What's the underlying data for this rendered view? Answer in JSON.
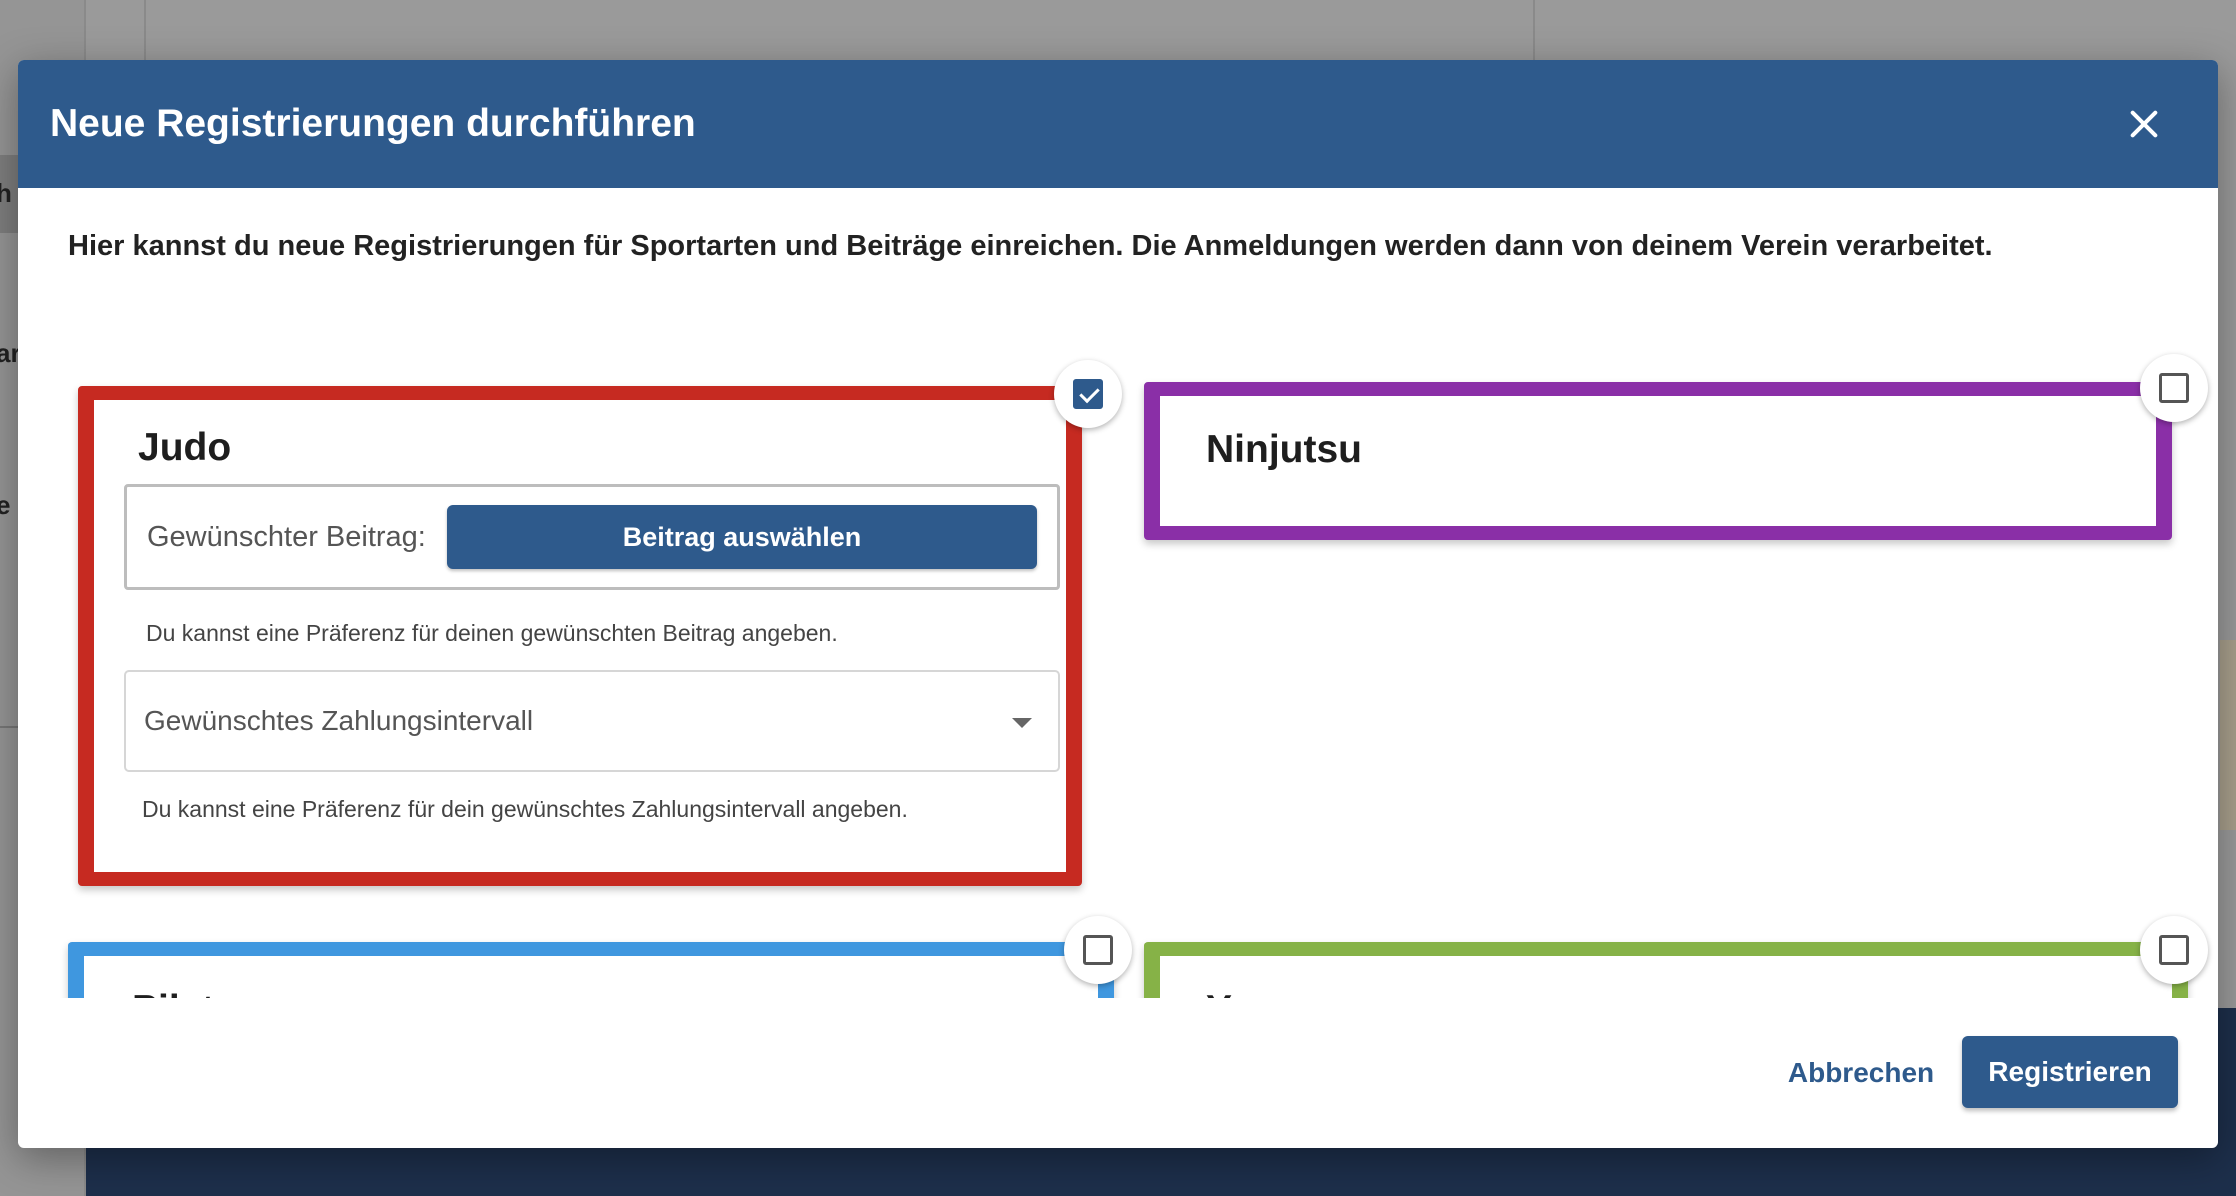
{
  "background": {
    "fragments": [
      "h",
      "ar",
      "e"
    ]
  },
  "dialog": {
    "title": "Neue Registrierungen durchführen",
    "close_icon": "close-icon",
    "intro": "Hier kannst du neue Registrierungen für Sportarten und Beiträge einreichen. Die Anmeldungen werden dann von deinem Verein verarbeitet.",
    "cards": [
      {
        "name": "Judo",
        "checked": true,
        "color": "#c62a21",
        "beitrag_label": "Gewünschter Beitrag:",
        "beitrag_button": "Beitrag auswählen",
        "beitrag_help": "Du kannst eine Präferenz für deinen gewünschten Beitrag angeben.",
        "interval_placeholder": "Gewünschtes Zahlungsintervall",
        "interval_help": "Du kannst eine Präferenz für dein gewünschtes Zahlungsintervall angeben."
      },
      {
        "name": "Ninjutsu",
        "checked": false,
        "color": "#8a2fa7"
      },
      {
        "name": "Pilates",
        "checked": false,
        "color": "#3f97df"
      },
      {
        "name": "Yoga",
        "checked": false,
        "color": "#86b247"
      }
    ],
    "footer": {
      "cancel_label": "Abbrechen",
      "register_label": "Registrieren"
    }
  },
  "colors": {
    "primary": "#2e5a8c",
    "header_bg": "#2e5a8c"
  }
}
